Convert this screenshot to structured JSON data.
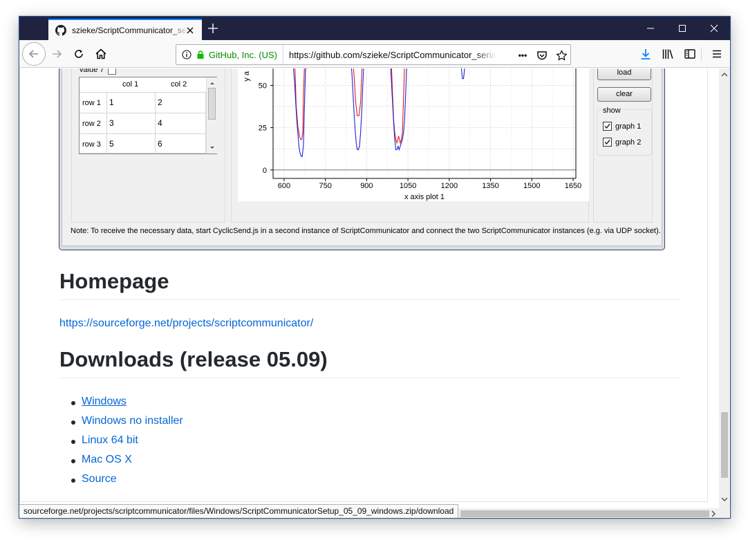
{
  "browser": {
    "tab_title": "szieke/ScriptCommunicator_serial-terminal",
    "identity_org": "GitHub, Inc. (US)",
    "url": "https://github.com/szieke/ScriptCommunicator_serial-terminal",
    "status_url": "sourceforge.net/projects/scriptcommunicator/files/Windows/ScriptCommunicatorSetup_05_09_windows.zip/download",
    "page_actions_glyph": "•••",
    "accent_color": "#0a84ff",
    "titlebar_color": "#202340"
  },
  "app_screenshot": {
    "value_label": "value 7",
    "table": {
      "columns": [
        "col 1",
        "col 2"
      ],
      "rows": [
        {
          "header": "row 1",
          "cells": [
            "1",
            "2"
          ]
        },
        {
          "header": "row 2",
          "cells": [
            "3",
            "4"
          ]
        },
        {
          "header": "row 3",
          "cells": [
            "5",
            "6"
          ]
        }
      ]
    },
    "buttons": {
      "load": "load",
      "clear": "clear"
    },
    "show_group": {
      "title": "show",
      "items": [
        {
          "label": "graph 1",
          "checked": true
        },
        {
          "label": "graph 2",
          "checked": true
        }
      ]
    },
    "note": "Note: To receive the necessary data, start CyclicSend.js in a second instance of ScriptCommunicator and connect the two ScriptCommunicator instances (e.g. via UDP socket)."
  },
  "chart_data": {
    "type": "line",
    "title": "",
    "xlabel": "x axis plot 1",
    "ylabel": "y a",
    "xlim": [
      560,
      1660
    ],
    "ylim": [
      -5,
      60
    ],
    "x_ticks": [
      600,
      750,
      900,
      1050,
      1200,
      1350,
      1500,
      1650
    ],
    "y_ticks": [
      0,
      25,
      50
    ],
    "y_tick_labels": [
      "0",
      "25",
      "50"
    ],
    "grid": true,
    "series": [
      {
        "color": "#e31a1c",
        "x": [
          638,
          640,
          644,
          650,
          656,
          660,
          664,
          668,
          670,
          674,
          676,
          850,
          855,
          860,
          866,
          872,
          878,
          882,
          884,
          990,
          994,
          998,
          1002,
          1006,
          1010,
          1016,
          1022,
          1026,
          1030,
          1034,
          1038
        ],
        "y": [
          62,
          58,
          38,
          26,
          20,
          18,
          18,
          22,
          42,
          62,
          64,
          64,
          54,
          40,
          32,
          32,
          40,
          56,
          64,
          62,
          45,
          30,
          22,
          18,
          16,
          20,
          16,
          18,
          22,
          42,
          64
        ]
      },
      {
        "color": "#1f22d6",
        "x": [
          634,
          638,
          642,
          646,
          650,
          654,
          658,
          662,
          666,
          670,
          674,
          678,
          842,
          846,
          850,
          854,
          858,
          862,
          866,
          870,
          874,
          878,
          882,
          886,
          890,
          986,
          990,
          994,
          998,
          1002,
          1006,
          1010,
          1014,
          1018,
          1022,
          1026,
          1030,
          1034,
          1038,
          1042,
          1046
        ],
        "y": [
          60,
          52,
          40,
          30,
          22,
          14,
          10,
          8,
          8,
          14,
          38,
          60,
          64,
          58,
          46,
          34,
          24,
          16,
          12,
          12,
          14,
          22,
          34,
          50,
          64,
          64,
          52,
          40,
          28,
          18,
          12,
          12,
          14,
          12,
          14,
          16,
          18,
          22,
          30,
          46,
          64
        ]
      },
      {
        "color": "#1f22d6",
        "x": [
          1240,
          1244,
          1248,
          1252,
          1256,
          1260,
          1300,
          1304,
          1308,
          1312,
          1316,
          1352,
          1356,
          1360,
          1364
        ],
        "y": [
          64,
          60,
          54,
          54,
          60,
          64,
          64,
          62,
          62,
          62,
          64,
          64,
          62,
          62,
          64
        ]
      }
    ]
  },
  "homepage": {
    "heading": "Homepage",
    "link": "https://sourceforge.net/projects/scriptcommunicator/"
  },
  "downloads": {
    "heading": "Downloads (release 05.09)",
    "items": [
      "Windows",
      "Windows no installer",
      "Linux 64 bit",
      "Mac OS X",
      "Source"
    ]
  }
}
